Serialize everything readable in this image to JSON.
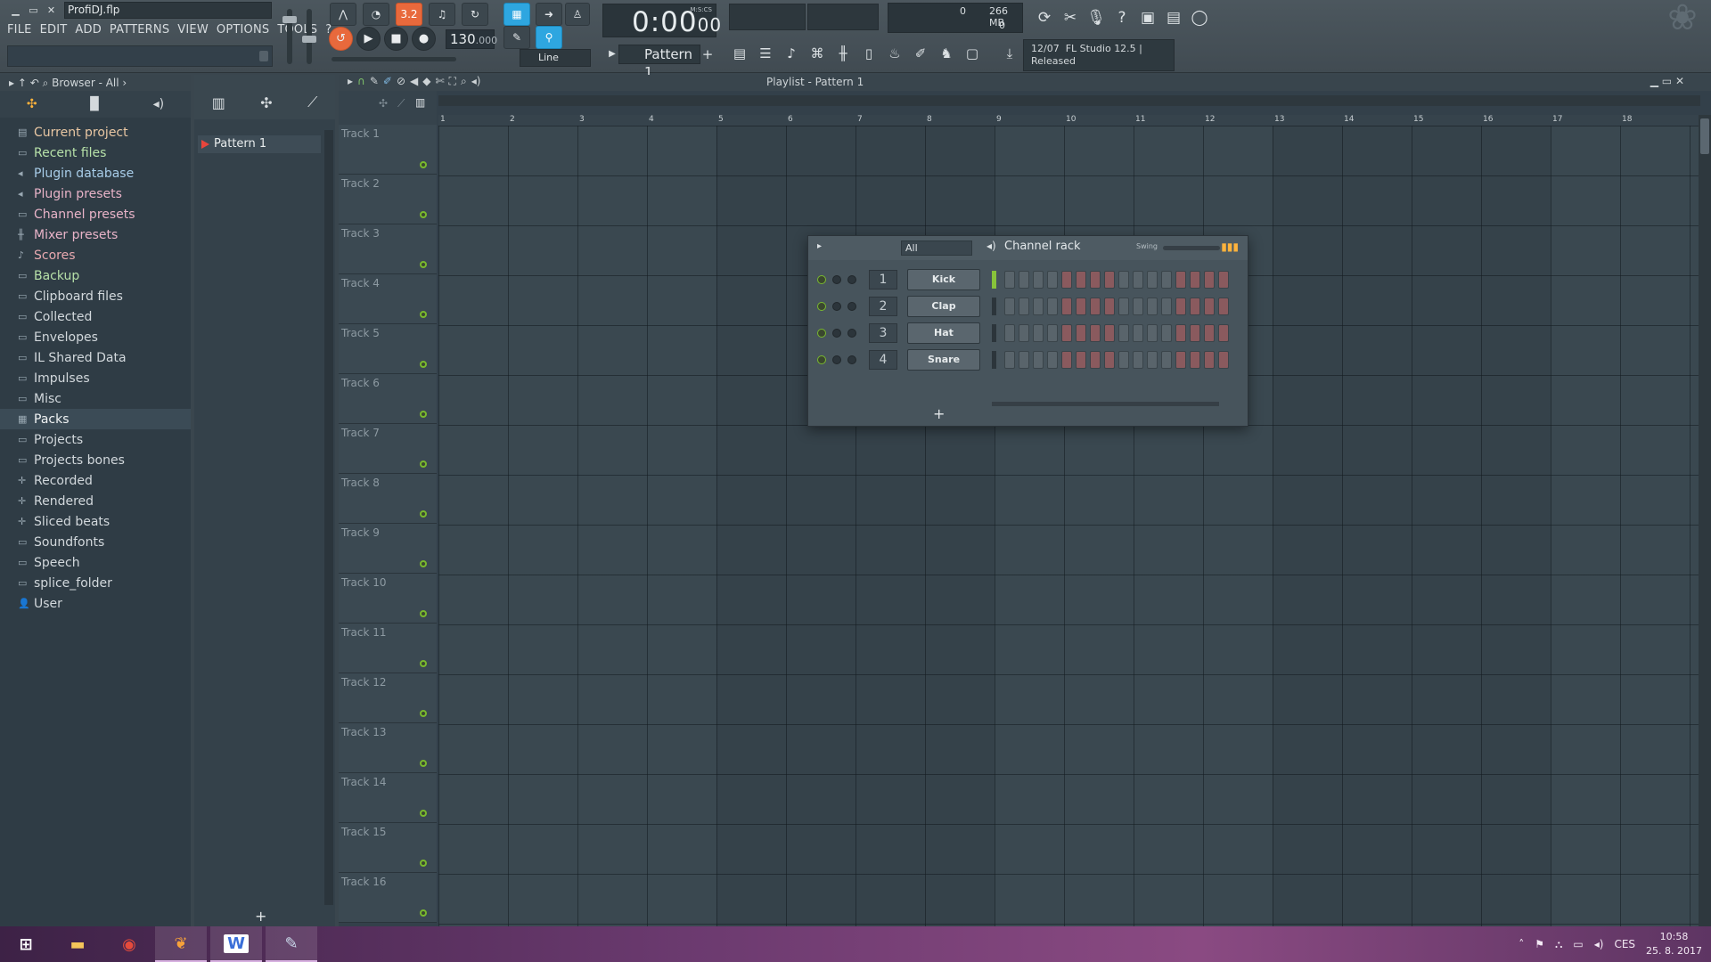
{
  "window": {
    "title": "ProfiDJ.flp"
  },
  "menu": [
    "FILE",
    "EDIT",
    "ADD",
    "PATTERNS",
    "VIEW",
    "OPTIONS",
    "TOOLS",
    "?"
  ],
  "transport": {
    "pattern_song": "3.2",
    "tempo_main": "130",
    "tempo_dec": ".000",
    "time_main": "0:00",
    "time_sub": "00",
    "time_unit": "M:S:CS",
    "snap": "Line",
    "pattern": "Pattern 1"
  },
  "status": {
    "cpu_value": "0",
    "memory": "266 MB",
    "polyphony": "0"
  },
  "news": {
    "date": "12/07",
    "line1": "FL Studio 12.5 |",
    "line2": "Released"
  },
  "browser": {
    "header": "Browser - All",
    "items": [
      {
        "label": "Current project",
        "icon": "project-icon",
        "color": "orange"
      },
      {
        "label": "Recent files",
        "icon": "folder-icon",
        "color": "green"
      },
      {
        "label": "Plugin database",
        "icon": "plugin-icon",
        "color": "blue"
      },
      {
        "label": "Plugin presets",
        "icon": "plugin-icon",
        "color": "pink"
      },
      {
        "label": "Channel presets",
        "icon": "channel-icon",
        "color": "pink"
      },
      {
        "label": "Mixer presets",
        "icon": "mixer-icon",
        "color": "pink"
      },
      {
        "label": "Scores",
        "icon": "note-icon",
        "color": "red"
      },
      {
        "label": "Backup",
        "icon": "folder-icon",
        "color": "green"
      },
      {
        "label": "Clipboard files",
        "icon": "folder-icon",
        "color": ""
      },
      {
        "label": "Collected",
        "icon": "folder-icon",
        "color": ""
      },
      {
        "label": "Envelopes",
        "icon": "folder-icon",
        "color": ""
      },
      {
        "label": "IL Shared Data",
        "icon": "folder-icon",
        "color": ""
      },
      {
        "label": "Impulses",
        "icon": "folder-icon",
        "color": ""
      },
      {
        "label": "Misc",
        "icon": "folder-icon",
        "color": ""
      },
      {
        "label": "Packs",
        "icon": "packs-icon",
        "color": "",
        "selected": true
      },
      {
        "label": "Projects",
        "icon": "folder-icon",
        "color": ""
      },
      {
        "label": "Projects bones",
        "icon": "folder-icon",
        "color": ""
      },
      {
        "label": "Recorded",
        "icon": "plus-icon",
        "color": ""
      },
      {
        "label": "Rendered",
        "icon": "plus-icon",
        "color": ""
      },
      {
        "label": "Sliced beats",
        "icon": "plus-icon",
        "color": ""
      },
      {
        "label": "Soundfonts",
        "icon": "folder-icon",
        "color": ""
      },
      {
        "label": "Speech",
        "icon": "folder-icon",
        "color": ""
      },
      {
        "label": "splice_folder",
        "icon": "folder-icon",
        "color": ""
      },
      {
        "label": "User",
        "icon": "user-icon",
        "color": ""
      }
    ]
  },
  "picker": {
    "pattern": "Pattern 1"
  },
  "playlist": {
    "title": "Playlist - Pattern 1",
    "tracks": [
      "Track 1",
      "Track 2",
      "Track 3",
      "Track 4",
      "Track 5",
      "Track 6",
      "Track 7",
      "Track 8",
      "Track 9",
      "Track 10",
      "Track 11",
      "Track 12",
      "Track 13",
      "Track 14",
      "Track 15",
      "Track 16"
    ],
    "bars": [
      "1",
      "2",
      "3",
      "4",
      "5",
      "6",
      "7",
      "8",
      "9",
      "10",
      "11",
      "12",
      "13",
      "14",
      "15",
      "16",
      "17",
      "18"
    ]
  },
  "channel_rack": {
    "filter": "All",
    "title": "Channel rack",
    "swing_label": "Swing",
    "channels": [
      {
        "num": "1",
        "name": "Kick",
        "selected": true
      },
      {
        "num": "2",
        "name": "Clap",
        "selected": false
      },
      {
        "num": "3",
        "name": "Hat",
        "selected": false
      },
      {
        "num": "4",
        "name": "Snare",
        "selected": false
      }
    ]
  },
  "taskbar": {
    "apps": [
      "start",
      "file-explorer",
      "chrome",
      "fl-studio",
      "word",
      "paint"
    ],
    "word_letter": "W",
    "lang": "CES",
    "time": "10:58",
    "date": "25. 8. 2017"
  },
  "colors": {
    "accent_orange": "#e8693c",
    "accent_blue": "#2ea6e0",
    "led_green": "#79b92e",
    "step_red": "#8a5a5e"
  }
}
